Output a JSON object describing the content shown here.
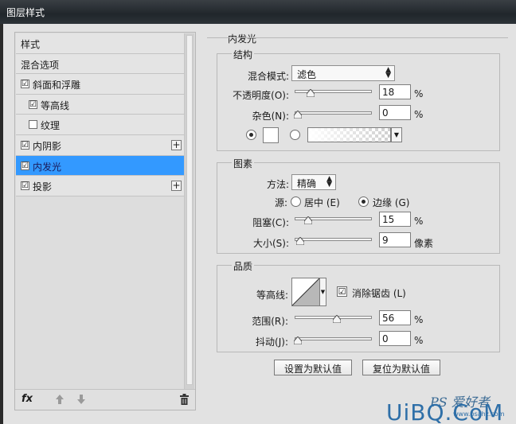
{
  "window": {
    "title": "图层样式"
  },
  "sidebar": {
    "items": [
      {
        "label": "样式",
        "checkbox": false
      },
      {
        "label": "混合选项",
        "checkbox": false
      },
      {
        "label": "斜面和浮雕",
        "checkbox": true,
        "checked": true
      },
      {
        "label": "等高线",
        "checkbox": true,
        "checked": true
      },
      {
        "label": "纹理",
        "checkbox": true,
        "checked": false
      },
      {
        "label": "内阴影",
        "checkbox": true,
        "checked": true,
        "plus": true
      },
      {
        "label": "内发光",
        "checkbox": true,
        "checked": true,
        "selected": true
      },
      {
        "label": "投影",
        "checkbox": true,
        "checked": true,
        "plus": true
      }
    ],
    "footer": {
      "fx_label": "fx"
    },
    "checkmark": "☑",
    "plus_glyph": "+"
  },
  "panel": {
    "title": "内发光",
    "structure": {
      "title": "结构",
      "blend_mode_label": "混合模式:",
      "blend_mode_value": "滤色",
      "opacity_label": "不透明度(O):",
      "opacity_value": "18",
      "opacity_unit": "%",
      "noise_label": "杂色(N):",
      "noise_value": "0",
      "noise_unit": "%",
      "color_hex": "#ffffff"
    },
    "elements": {
      "title": "图素",
      "method_label": "方法:",
      "method_value": "精确",
      "source_label": "源:",
      "source_center_label": "居中 (E)",
      "source_edge_label": "边缘 (G)",
      "choke_label": "阻塞(C):",
      "choke_value": "15",
      "choke_unit": "%",
      "size_label": "大小(S):",
      "size_value": "9",
      "size_unit": "像素"
    },
    "quality": {
      "title": "品质",
      "contour_label": "等高线:",
      "antialias_label": "消除锯齿 (L)",
      "range_label": "范围(R):",
      "range_value": "56",
      "range_unit": "%",
      "jitter_label": "抖动(J):",
      "jitter_value": "0",
      "jitter_unit": "%"
    },
    "buttons": {
      "set_default": "设置为默认值",
      "reset_default": "复位为默认值"
    }
  },
  "sliders": {
    "opacity": 0.18,
    "noise": 0,
    "choke": 0.15,
    "size": 0.04,
    "range": 0.56,
    "jitter": 0
  },
  "watermark": {
    "ps": "PS 爱好者",
    "logo": "UiBQ.CoM",
    "site": "www.psahz.com"
  },
  "colors": {
    "selection": "#3399ff",
    "dialog_bg": "#e2e2e2"
  }
}
